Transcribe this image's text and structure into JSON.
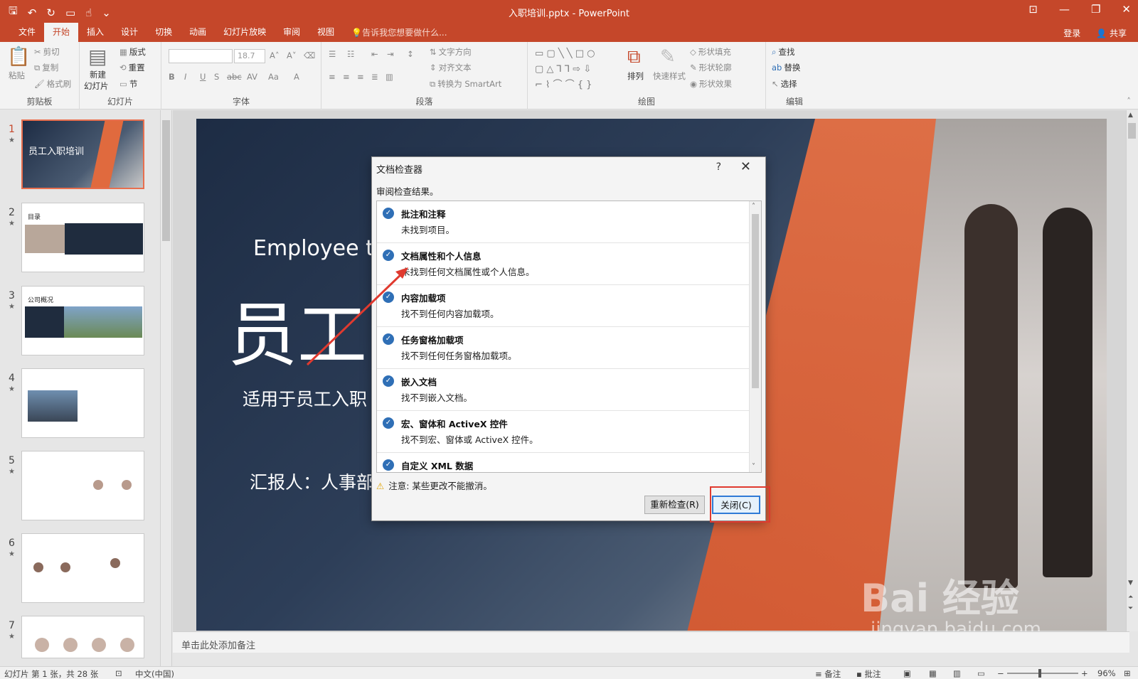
{
  "window": {
    "title": "入职培训.pptx - PowerPoint"
  },
  "menu": {
    "tabs": [
      "文件",
      "开始",
      "插入",
      "设计",
      "切换",
      "动画",
      "幻灯片放映",
      "审阅",
      "视图"
    ],
    "active_tab": "开始",
    "tell_me": "告诉我您想要做什么...",
    "login": "登录",
    "share": "共享"
  },
  "ribbon": {
    "clipboard": {
      "label": "剪贴板",
      "paste": "粘贴",
      "cut": "剪切",
      "copy": "复制",
      "format_painter": "格式刷"
    },
    "slides": {
      "label": "幻灯片",
      "new_slide_1": "新建",
      "new_slide_2": "幻灯片",
      "layout": "版式",
      "reset": "重置",
      "section": "节"
    },
    "font": {
      "label": "字体",
      "font_name": "",
      "font_size": "18.7"
    },
    "paragraph": {
      "label": "段落",
      "text_direction": "文字方向",
      "align_text": "对齐文本",
      "smartart": "转换为 SmartArt"
    },
    "drawing": {
      "label": "绘图",
      "arrange": "排列",
      "quick_styles": "快速样式",
      "shape_fill": "形状填充",
      "shape_outline": "形状轮廓",
      "shape_effects": "形状效果"
    },
    "editing": {
      "label": "编辑",
      "find": "查找",
      "replace": "替换",
      "select": "选择"
    }
  },
  "thumbnails": [
    {
      "num": "1",
      "title": "员工入职培训"
    },
    {
      "num": "2",
      "title": "目录"
    },
    {
      "num": "3",
      "title": "公司概况"
    },
    {
      "num": "4",
      "title": ""
    },
    {
      "num": "5",
      "title": ""
    },
    {
      "num": "6",
      "title": ""
    },
    {
      "num": "7",
      "title": ""
    }
  ],
  "slide": {
    "subtitle_en": "Employee t",
    "title_cn": "员工",
    "desc_cn": "适用于员工入职",
    "reporter": "汇报人：人事部"
  },
  "notes_placeholder": "单击此处添加备注",
  "status": {
    "slide_info": "幻灯片 第 1 张，共 28 张",
    "language": "中文(中国)",
    "notes": "备注",
    "comments": "批注",
    "zoom": "96%"
  },
  "dialog": {
    "title": "文档检查器",
    "help": "?",
    "subtitle": "审阅检查结果。",
    "items": [
      {
        "title": "批注和注释",
        "desc": "未找到项目。"
      },
      {
        "title": "文档属性和个人信息",
        "desc": "未找到任何文档属性或个人信息。"
      },
      {
        "title": "内容加载项",
        "desc": "找不到任何内容加载项。"
      },
      {
        "title": "任务窗格加载项",
        "desc": "找不到任何任务窗格加载项。"
      },
      {
        "title": "嵌入文档",
        "desc": "找不到嵌入文档。"
      },
      {
        "title": "宏、窗体和 ActiveX 控件",
        "desc": "找不到宏、窗体或 ActiveX 控件。"
      },
      {
        "title": "自定义 XML 数据",
        "desc": ""
      }
    ],
    "warning": "注意: 某些更改不能撤消。",
    "reinspect_button": "重新检查(R)",
    "close_button": "关闭(C)"
  },
  "watermark": {
    "logo": "Bai 经验",
    "url": "jingyan.baidu.com"
  },
  "colors": {
    "accent": "#c5472a",
    "check": "#2f6fb6",
    "highlight": "#e03a2f"
  }
}
